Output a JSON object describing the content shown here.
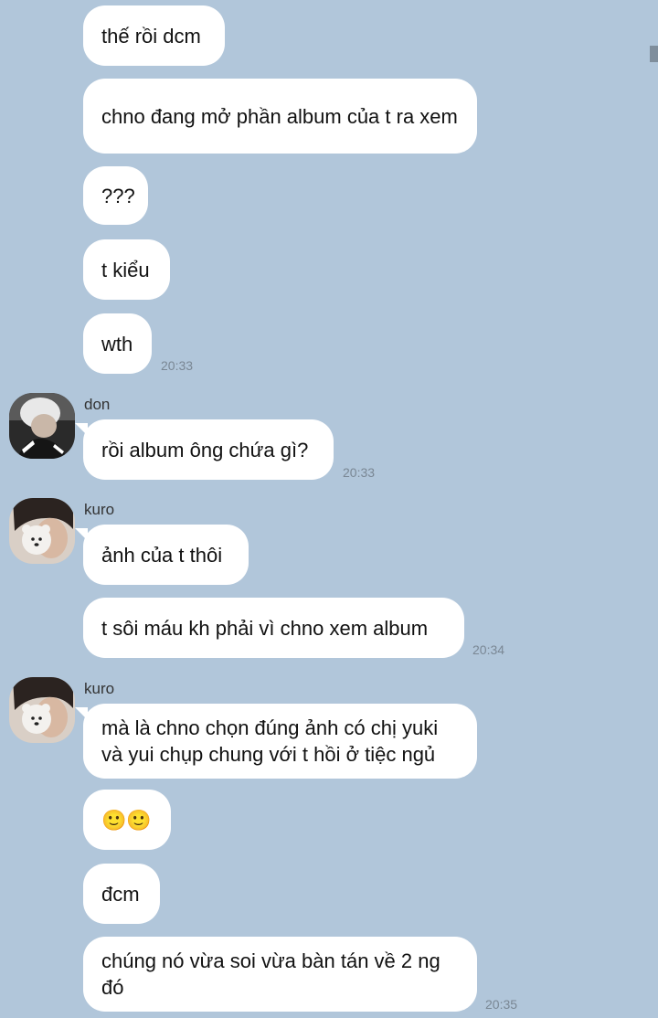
{
  "messages": [
    {
      "text": "thế rồi dcm"
    },
    {
      "text": "chno đang mở phần album của t ra xem"
    },
    {
      "text": "???"
    },
    {
      "text": "t kiểu"
    },
    {
      "text": "wth",
      "time": "20:33"
    },
    {
      "sender": "don",
      "text": "rồi album ông chứa gì?",
      "time": "20:33"
    },
    {
      "sender": "kuro",
      "text": "ảnh của t thôi"
    },
    {
      "text": "t sôi máu kh phải vì chno xem album",
      "time": "20:34"
    },
    {
      "sender": "kuro",
      "text": "mà là chno chọn đúng ảnh có chị yuki và yui chụp chung với t hồi ở tiệc ngủ"
    },
    {
      "text": "🙂🙂"
    },
    {
      "text": "đcm"
    },
    {
      "text": "chúng nó vừa soi vừa bàn tán về 2 ng đó",
      "time": "20:35"
    }
  ],
  "avatars": {
    "don": "avatar-photo-don",
    "kuro": "avatar-photo-kuro"
  },
  "colors": {
    "background": "#b1c6da",
    "bubble": "#ffffff",
    "timestamp": "#7a8794"
  }
}
